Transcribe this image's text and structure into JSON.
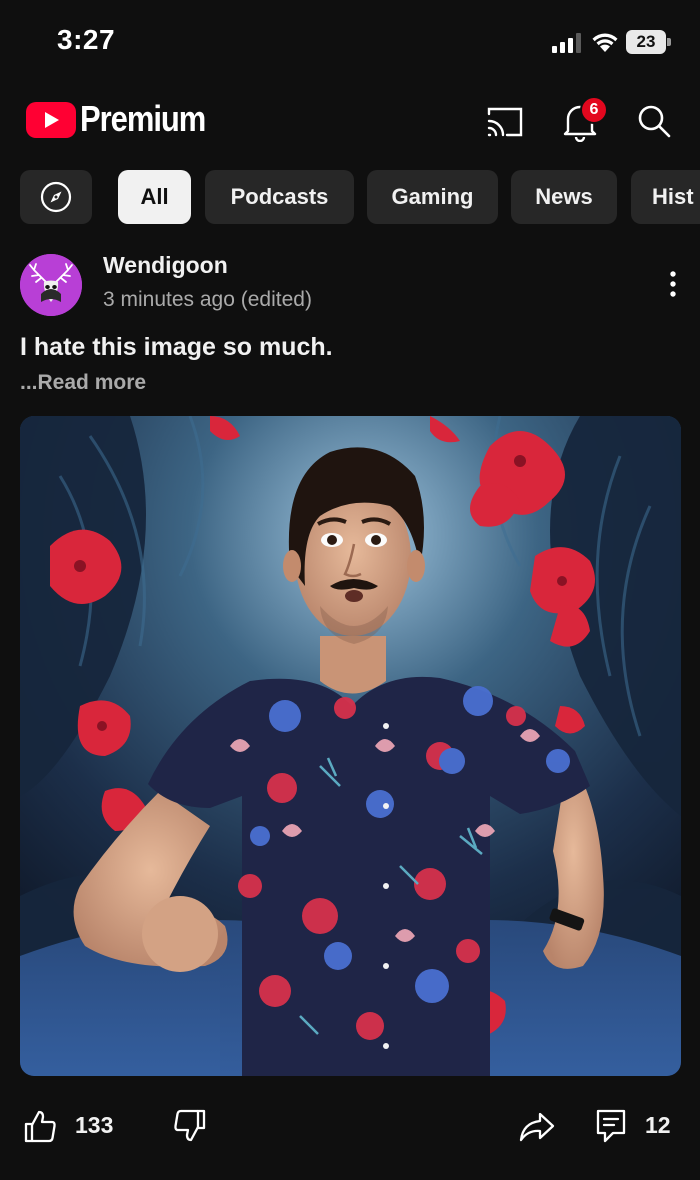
{
  "status_bar": {
    "time": "3:27",
    "battery": "23"
  },
  "header": {
    "logo_text": "Premium",
    "notification_count": "6"
  },
  "chips": [
    {
      "label": "All",
      "active": true
    },
    {
      "label": "Podcasts",
      "active": false
    },
    {
      "label": "Gaming",
      "active": false
    },
    {
      "label": "News",
      "active": false
    },
    {
      "label": "Hist",
      "active": false
    }
  ],
  "post": {
    "channel_name": "Wendigoon",
    "timestamp": "3 minutes ago (edited)",
    "text": "I hate this image so much.",
    "read_more": "...Read more",
    "like_count": "133",
    "comment_count": "12"
  },
  "colors": {
    "background": "#0f0f0f",
    "brand_red": "#ff0033",
    "chip_bg": "#272727",
    "chip_active_bg": "#f1f1f1",
    "badge_red": "#e3071e",
    "avatar_bg": "#b83fd6"
  }
}
